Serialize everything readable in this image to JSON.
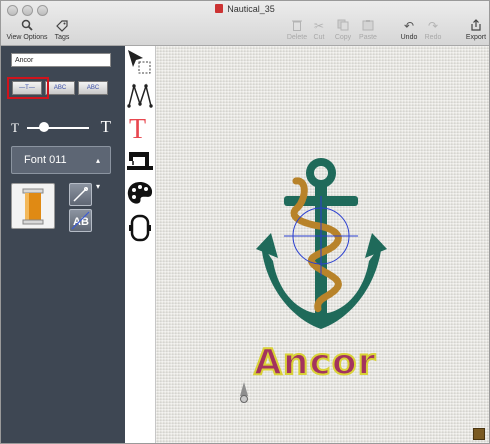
{
  "window": {
    "title": "Nautical_35"
  },
  "toolbar": {
    "view_options_label": "View Options",
    "tags_label": "Tags",
    "delete_label": "Delete",
    "cut_label": "Cut",
    "copy_label": "Copy",
    "paste_label": "Paste",
    "undo_label": "Undo",
    "redo_label": "Redo",
    "export_label": "Export"
  },
  "left_panel": {
    "text_value": "Ancor",
    "font_name": "Font 011",
    "text_layout_options": [
      "straight-text",
      "arc-text-up",
      "arc-text-down"
    ],
    "selected_layout": "straight-text"
  },
  "tools": [
    "select-tool",
    "node-edit-tool",
    "text-tool",
    "stitch-tool",
    "color-palette-tool",
    "hoop-tool"
  ],
  "selected_tool": "text-tool",
  "canvas": {
    "design_text": "Ancor",
    "design_text_color": "#a3335e",
    "design_outline_color": "#d9d237",
    "anchor_color": "#1f6a5a",
    "rope_color": "#b8832a",
    "accent_color": "#d0131c"
  }
}
